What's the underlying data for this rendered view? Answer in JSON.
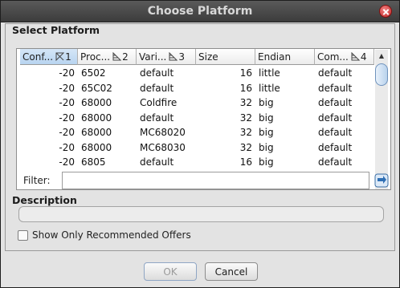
{
  "window": {
    "title": "Choose Platform"
  },
  "select_platform": {
    "heading": "Select Platform",
    "columns": [
      {
        "label": "Conf...",
        "sort_order": "1"
      },
      {
        "label": "Proc...",
        "sort_order": "2"
      },
      {
        "label": "Vari...",
        "sort_order": "3"
      },
      {
        "label": "Size",
        "sort_order": ""
      },
      {
        "label": "Endian",
        "sort_order": ""
      },
      {
        "label": "Com...",
        "sort_order": "4"
      }
    ],
    "rows": [
      [
        "-20",
        "6502",
        "default",
        "16",
        "little",
        "default"
      ],
      [
        "-20",
        "65C02",
        "default",
        "16",
        "little",
        "default"
      ],
      [
        "-20",
        "68000",
        "Coldfire",
        "32",
        "big",
        "default"
      ],
      [
        "-20",
        "68000",
        "default",
        "32",
        "big",
        "default"
      ],
      [
        "-20",
        "68000",
        "MC68020",
        "32",
        "big",
        "default"
      ],
      [
        "-20",
        "68000",
        "MC68030",
        "32",
        "big",
        "default"
      ],
      [
        "-20",
        "6805",
        "default",
        "16",
        "big",
        "default"
      ]
    ],
    "filter": {
      "label": "Filter:",
      "value": ""
    }
  },
  "description": {
    "heading": "Description"
  },
  "recommended": {
    "label": "Show Only Recommended Offers"
  },
  "buttons": {
    "ok": "OK",
    "cancel": "Cancel"
  },
  "colors": {
    "title_bar": "#4a4a4a",
    "selected_header": "#c6dcf2",
    "scroll_thumb": "#b9d2ec"
  }
}
